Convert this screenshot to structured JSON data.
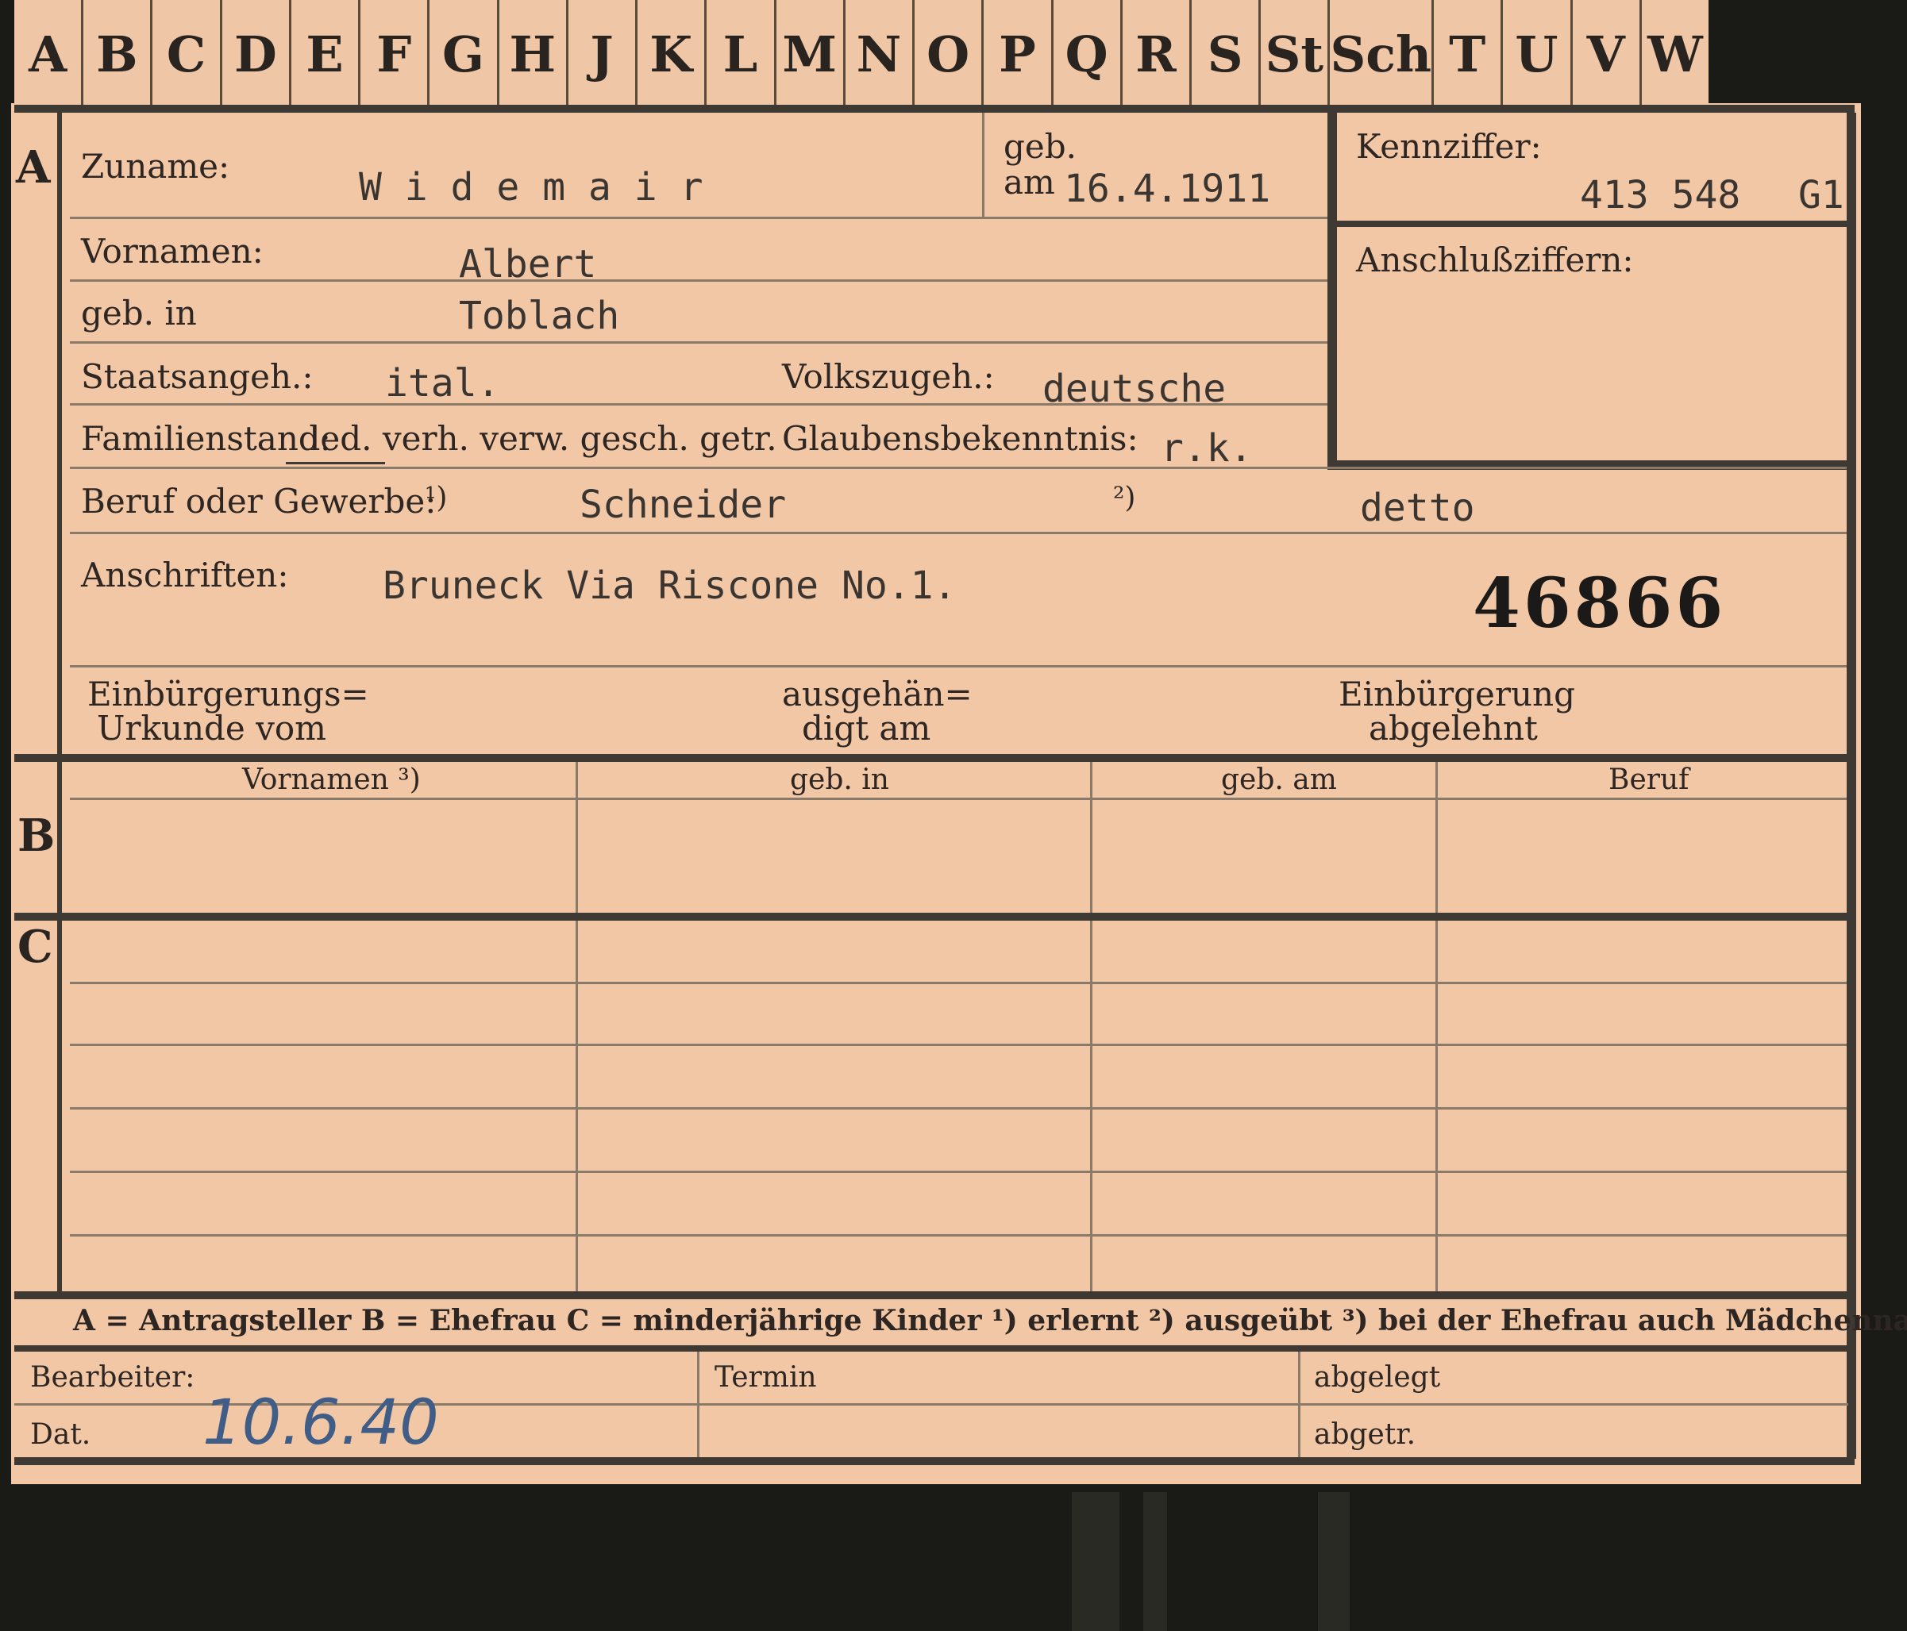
{
  "tabs": [
    "A",
    "B",
    "C",
    "D",
    "E",
    "F",
    "G",
    "H",
    "J",
    "K",
    "L",
    "M",
    "N",
    "O",
    "P",
    "Q",
    "R",
    "S",
    "St",
    "Sch",
    "T",
    "U",
    "V",
    "W"
  ],
  "section_a": {
    "marker": "A",
    "zuname_label": "Zuname:",
    "zuname_value": "W i d e m a i r",
    "geb_label": "geb.",
    "am_label": "am",
    "geb_am_value": "16.4.1911",
    "vornamen_label": "Vornamen:",
    "vornamen_value": "Albert",
    "geb_in_label": "geb. in",
    "geb_in_value": "Toblach",
    "staatsangeh_label": "Staatsangeh.:",
    "staatsangeh_value": "ital.",
    "volkszugeh_label": "Volkszugeh.:",
    "volkszugeh_value": "deutsche",
    "familienstand_label": "Familienstand:",
    "familienstand_options": "led. verh. verw. gesch. getr.",
    "glaubens_label": "Glaubensbekenntnis:",
    "glaubens_value": "r.k.",
    "beruf_label": "Beruf oder Gewerbe:",
    "beruf_note1": "¹)",
    "beruf_value1": "Schneider",
    "beruf_note2": "²)",
    "beruf_value2": "detto",
    "anschriften_label": "Anschriften:",
    "anschriften_value": "Bruneck Via Riscone No.1.",
    "stamp_number": "46866",
    "einb_urkunde_label_1": "Einbürgerungs=",
    "einb_urkunde_label_2": "Urkunde vom",
    "ausgehaendigt_label_1": "ausgehän=",
    "ausgehaendigt_label_2": "digt am",
    "einb_abgelehnt_label_1": "Einbürgerung",
    "einb_abgelehnt_label_2": "abgelehnt"
  },
  "kennziffer": {
    "label": "Kennziffer:",
    "value": "413 548",
    "suffix": "G1",
    "anschluss_label": "Anschlußziffern:"
  },
  "section_b": {
    "marker": "B",
    "columns": [
      "Vornamen ³)",
      "geb. in",
      "geb. am",
      "Beruf"
    ]
  },
  "section_c": {
    "marker": "C"
  },
  "legend": "A = Antragsteller   B = Ehefrau   C = minderjährige Kinder   ¹) erlernt   ²) ausgeübt   ³) bei der Ehefrau auch Mädchenname",
  "footer": {
    "bearbeiter_label": "Bearbeiter:",
    "dat_label": "Dat.",
    "dat_value": "10.6.40",
    "termin_label": "Termin",
    "abgelegt_label": "abgelegt",
    "abgetr_label": "abgetr."
  }
}
